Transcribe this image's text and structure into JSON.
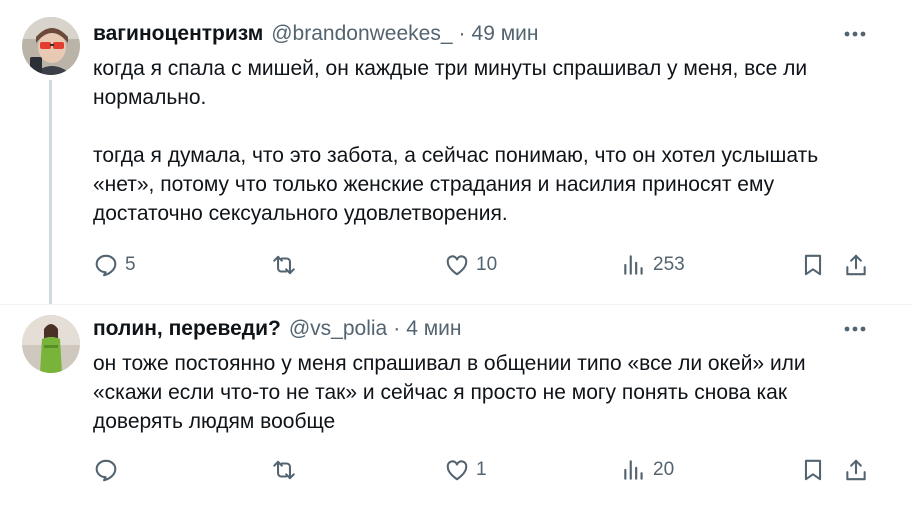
{
  "tweets": [
    {
      "author_name": "вагиноцентризм",
      "handle": "@brandonweekes_",
      "separator": "·",
      "time": "49 мин",
      "paragraphs": [
        "когда я спала с мишей, он каждые три минуты спрашивал у меня, все ли нормально.",
        "тогда я думала, что это забота, а сейчас понимаю, что он хотел услышать «нет», потому что только женские страдания и насилия приносят ему достаточно сексуального удовлетворения."
      ],
      "replies": "5",
      "retweets": "",
      "likes": "10",
      "views": "253"
    },
    {
      "author_name": "полин, переведи?",
      "handle": "@vs_polia",
      "separator": "·",
      "time": "4 мин",
      "paragraphs": [
        "он тоже постоянно у меня спрашивал в общении типо «все ли окей» или «скажи если что-то не так» и сейчас я просто не могу понять снова как доверять людям вообще"
      ],
      "replies": "",
      "retweets": "",
      "likes": "1",
      "views": "20"
    }
  ],
  "icons": {
    "more": "more-horizontal-icon",
    "reply": "reply-icon",
    "retweet": "retweet-icon",
    "like": "heart-icon",
    "views": "views-chart-icon",
    "bookmark": "bookmark-icon",
    "share": "share-icon"
  },
  "colors": {
    "text": "#0f1419",
    "secondary": "#536471",
    "thread_line": "#cfd9de",
    "divider": "#eff3f4"
  }
}
